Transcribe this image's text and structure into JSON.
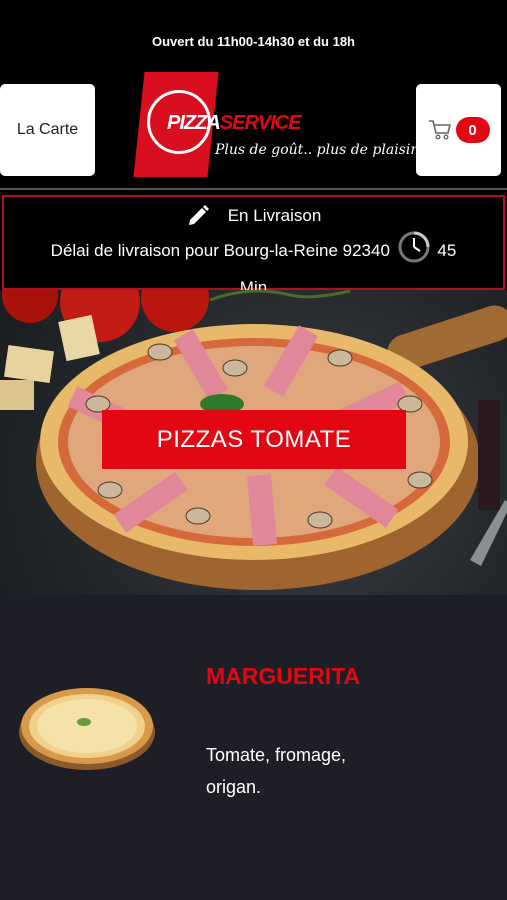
{
  "header": {
    "opening_hours": "Ouvert du 11h00-14h30 et du 18h",
    "menu_label": "La Carte",
    "cart_count": "0",
    "logo": {
      "word_1": "PIZZA",
      "word_2": "SERVICE",
      "tagline": "Plus de goût.. plus de plaisir !"
    }
  },
  "delivery": {
    "mode": "En Livraison",
    "text": "Délai de livraison pour Bourg-la-Reine 92340",
    "time_value": "45",
    "time_unit": "Min"
  },
  "category": {
    "label": "PIZZAS TOMATE"
  },
  "product": {
    "name": "MARGUERITA",
    "description": "Tomate, fromage, origan."
  },
  "colors": {
    "accent": "#e30613",
    "background": "#000000",
    "product_background": "#1d1e26"
  },
  "icons": {
    "edit": "pencil-icon",
    "clock": "clock-icon",
    "cart": "cart-icon"
  }
}
